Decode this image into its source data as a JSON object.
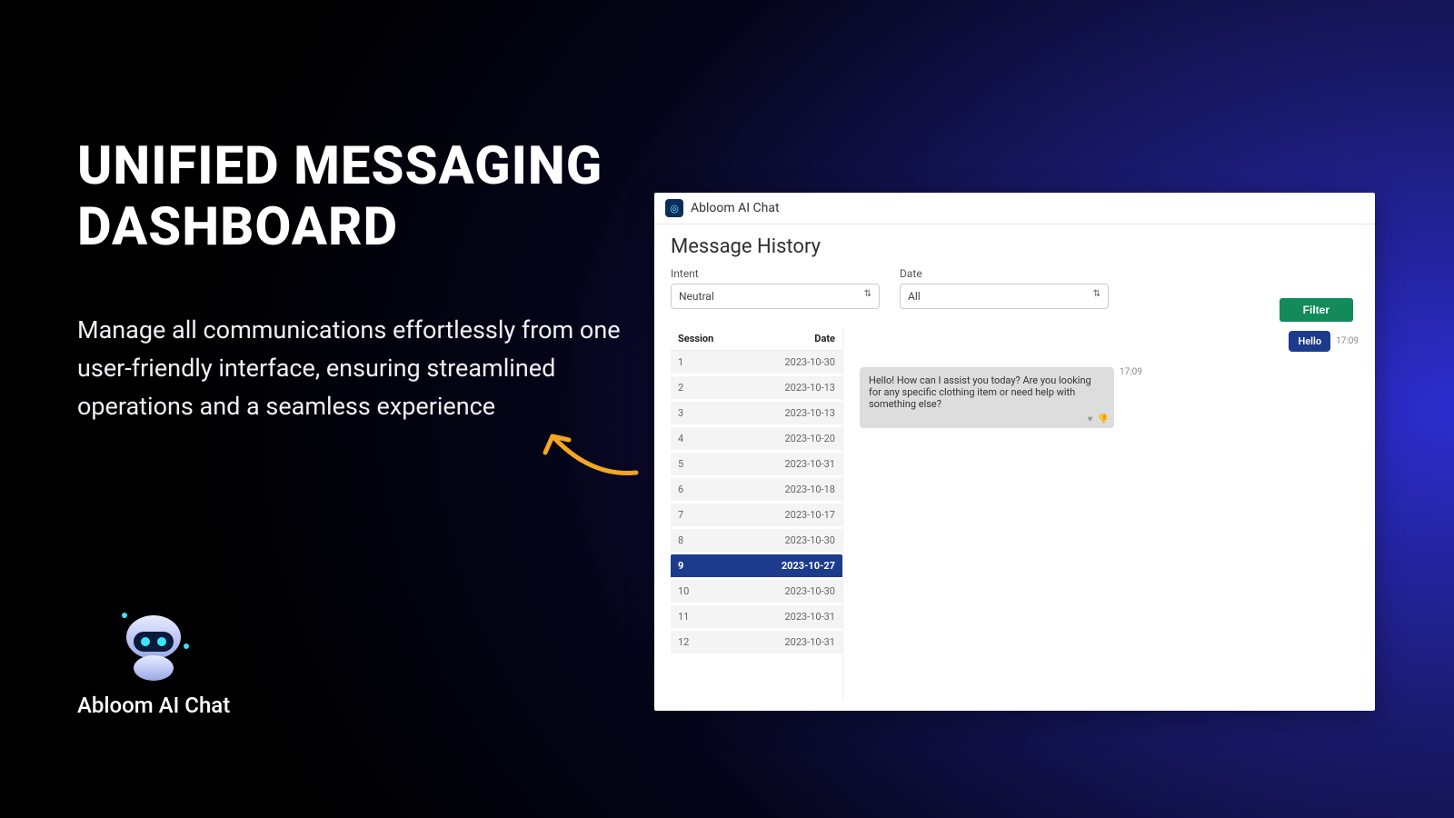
{
  "hero": {
    "title": "UNIFIED MESSAGING DASHBOARD",
    "subtitle": "Manage all communications effortlessly from one user-friendly interface, ensuring streamlined operations and a seamless experience"
  },
  "brand": {
    "name": "Abloom AI Chat"
  },
  "panel": {
    "app_name": "Abloom AI Chat",
    "page_title": "Message History",
    "filters": {
      "intent_label": "Intent",
      "intent_value": "Neutral",
      "date_label": "Date",
      "date_value": "All",
      "filter_button": "Filter"
    },
    "table": {
      "col_session": "Session",
      "col_date": "Date",
      "rows": [
        {
          "session": "1",
          "date": "2023-10-30",
          "selected": false
        },
        {
          "session": "2",
          "date": "2023-10-13",
          "selected": false
        },
        {
          "session": "3",
          "date": "2023-10-13",
          "selected": false
        },
        {
          "session": "4",
          "date": "2023-10-20",
          "selected": false
        },
        {
          "session": "5",
          "date": "2023-10-31",
          "selected": false
        },
        {
          "session": "6",
          "date": "2023-10-18",
          "selected": false
        },
        {
          "session": "7",
          "date": "2023-10-17",
          "selected": false
        },
        {
          "session": "8",
          "date": "2023-10-30",
          "selected": false
        },
        {
          "session": "9",
          "date": "2023-10-27",
          "selected": true
        },
        {
          "session": "10",
          "date": "2023-10-30",
          "selected": false
        },
        {
          "session": "11",
          "date": "2023-10-31",
          "selected": false
        },
        {
          "session": "12",
          "date": "2023-10-31",
          "selected": false
        }
      ]
    },
    "chat": {
      "user_message": "Hello",
      "user_time": "17:09",
      "bot_message": "Hello! How can I assist you today? Are you looking for any specific clothing item or need help with something else?",
      "bot_time": "17:09"
    }
  }
}
